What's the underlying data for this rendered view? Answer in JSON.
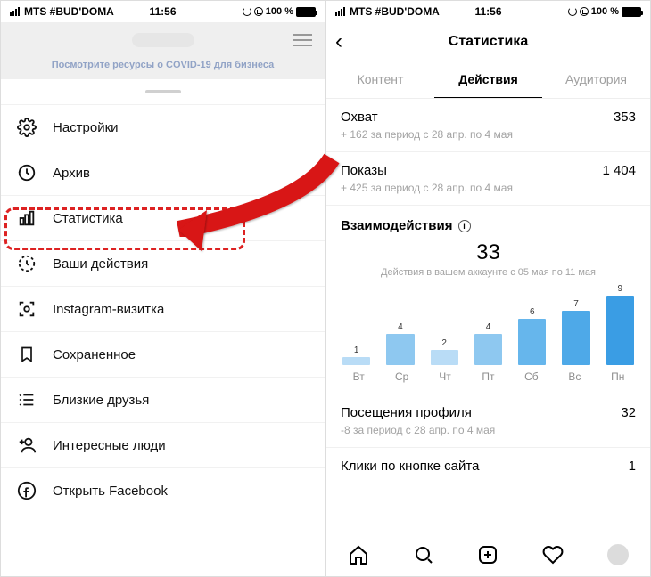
{
  "status_bar": {
    "carrier": "MTS #BUD'DOMA",
    "time": "11:56",
    "battery_text": "100 %"
  },
  "left_screen": {
    "covid_banner": "Посмотрите ресурсы о COVID-19 для бизнеса",
    "menu": [
      {
        "icon": "gear-icon",
        "label": "Настройки"
      },
      {
        "icon": "clock-icon",
        "label": "Архив"
      },
      {
        "icon": "stats-icon",
        "label": "Статистика"
      },
      {
        "icon": "activity-icon",
        "label": "Ваши действия"
      },
      {
        "icon": "scan-icon",
        "label": "Instagram-визитка"
      },
      {
        "icon": "bookmark-icon",
        "label": "Сохраненное"
      },
      {
        "icon": "list-star-icon",
        "label": "Близкие друзья"
      },
      {
        "icon": "add-user-icon",
        "label": "Интересные люди"
      },
      {
        "icon": "facebook-icon",
        "label": "Открыть Facebook"
      }
    ]
  },
  "right_screen": {
    "title": "Статистика",
    "tabs": {
      "content": "Контент",
      "actions": "Действия",
      "audience": "Аудитория"
    },
    "reach": {
      "label": "Охват",
      "value": "353",
      "sub": "+ 162 за период с 28 апр. по 4 мая"
    },
    "impressions": {
      "label": "Показы",
      "value": "1 404",
      "sub": "+ 425 за период с 28 апр. по 4 мая"
    },
    "interactions": {
      "title": "Взаимодействия",
      "total": "33",
      "sub": "Действия в вашем аккаунте с 05 мая по 11 мая"
    },
    "profile_visits": {
      "label": "Посещения профиля",
      "value": "32",
      "sub": "-8 за период с 28 апр. по 4 мая"
    },
    "site_clicks": {
      "label": "Клики по кнопке сайта",
      "value": "1"
    }
  },
  "chart_data": {
    "type": "bar",
    "categories": [
      "Вт",
      "Ср",
      "Чт",
      "Пт",
      "Сб",
      "Вс",
      "Пн"
    ],
    "values": [
      1,
      4,
      2,
      4,
      6,
      7,
      9
    ],
    "colors": [
      "#b9dcf6",
      "#8ec8f0",
      "#b9dcf6",
      "#8ec8f0",
      "#66b6ec",
      "#4ea9e8",
      "#3a9de4"
    ],
    "ylim": [
      0,
      9
    ],
    "title": "Взаимодействия"
  }
}
